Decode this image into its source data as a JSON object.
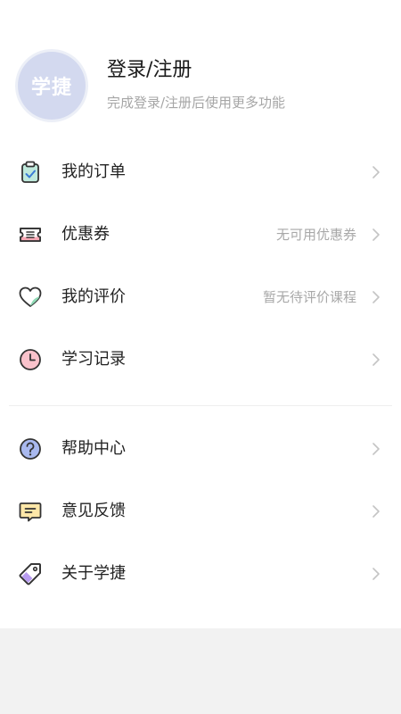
{
  "profile": {
    "avatar_text": "学捷",
    "title": "登录/注册",
    "subtitle": "完成登录/注册后使用更多功能"
  },
  "menu_group_1": [
    {
      "label": "我的订单",
      "hint": "",
      "icon": "clipboard-icon"
    },
    {
      "label": "优惠券",
      "hint": "无可用优惠券",
      "icon": "ticket-icon"
    },
    {
      "label": "我的评价",
      "hint": "暂无待评价课程",
      "icon": "heart-icon"
    },
    {
      "label": "学习记录",
      "hint": "",
      "icon": "clock-icon"
    }
  ],
  "menu_group_2": [
    {
      "label": "帮助中心",
      "hint": "",
      "icon": "help-icon"
    },
    {
      "label": "意见反馈",
      "hint": "",
      "icon": "feedback-icon"
    },
    {
      "label": "关于学捷",
      "hint": "",
      "icon": "tag-icon"
    }
  ],
  "colors": {
    "accent_blue": "#8fa4e8",
    "accent_pink": "#f7a7b4",
    "accent_green": "#8ed9b4",
    "accent_purple": "#b89cf0",
    "avatar_bg": "#d3d9ef"
  }
}
